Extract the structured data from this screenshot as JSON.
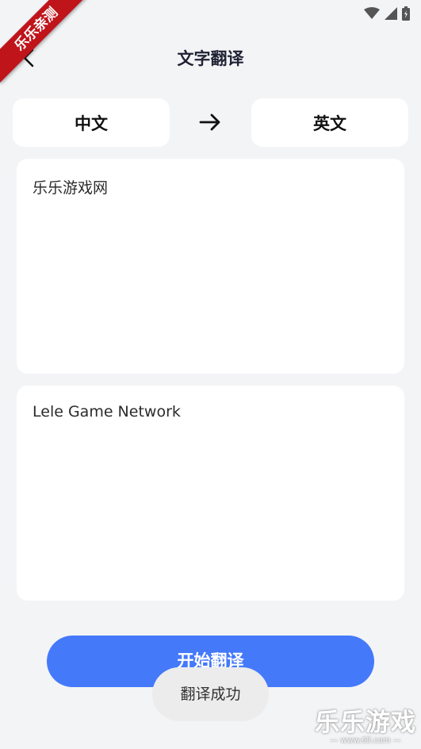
{
  "ribbon": {
    "label": "乐乐亲测"
  },
  "status_bar": {
    "icons": [
      "wifi-icon",
      "signal-icon",
      "battery-icon"
    ]
  },
  "header": {
    "title": "文字翻译",
    "back_icon": "back-arrow-icon"
  },
  "languages": {
    "source": "中文",
    "target": "英文",
    "arrow_icon": "right-arrow-icon"
  },
  "input": {
    "text": "乐乐游戏网"
  },
  "output": {
    "text": "Lele Game Network"
  },
  "actions": {
    "start_label": "开始翻译"
  },
  "toast": {
    "message": "翻译成功"
  },
  "watermark": {
    "title": "乐乐游戏",
    "url": "— www.6ll.com —"
  },
  "colors": {
    "background": "#f3f4f6",
    "accent": "#4479fa",
    "ribbon": "#c0141b"
  }
}
